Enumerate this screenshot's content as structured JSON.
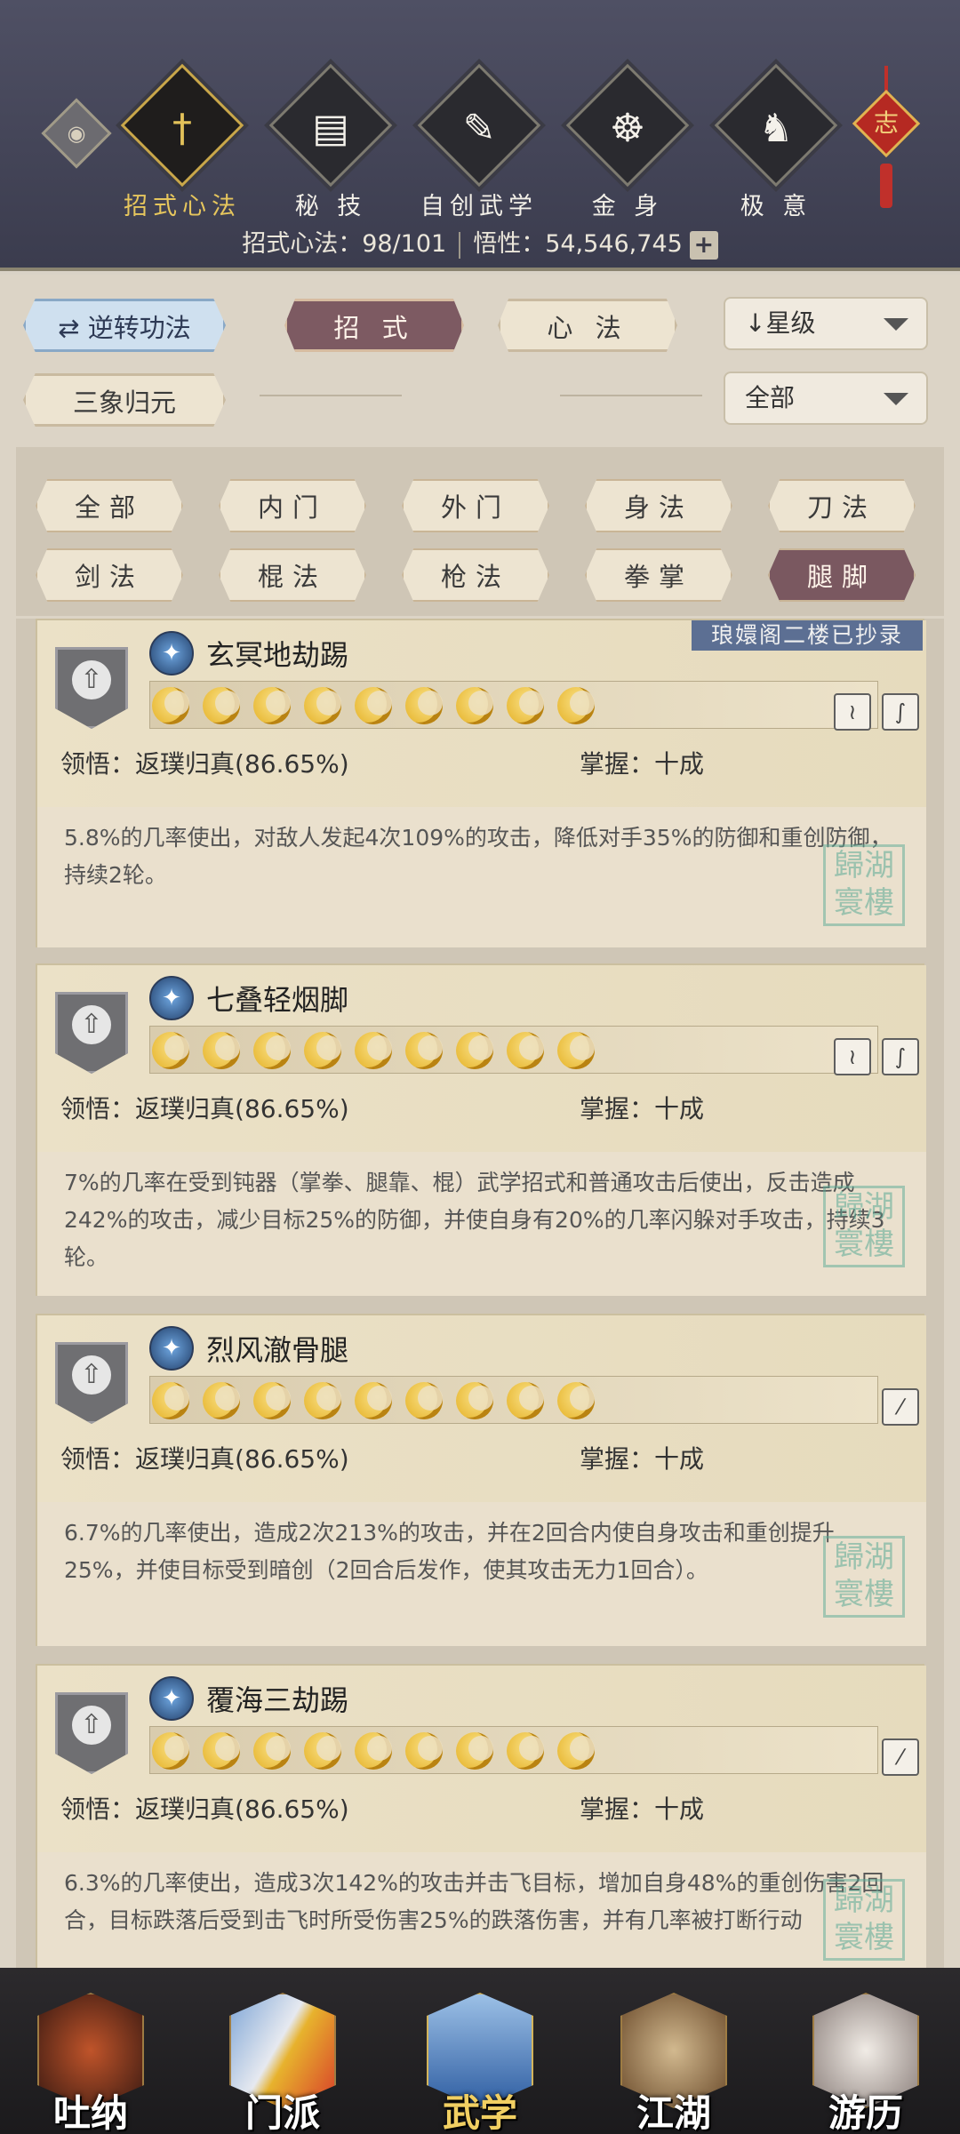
{
  "top_nav": {
    "tabs": [
      {
        "label": "招式心法",
        "icon": "sword-icon",
        "active": true
      },
      {
        "label": "秘 技",
        "icon": "scroll-book-icon",
        "active": false
      },
      {
        "label": "自创武学",
        "icon": "scroll-roll-icon",
        "active": false
      },
      {
        "label": "金 身",
        "icon": "meditation-icon",
        "active": false
      },
      {
        "label": "极 意",
        "icon": "martial-stance-icon",
        "active": false
      }
    ],
    "knot_char": "志",
    "eye_icon": "eye-icon"
  },
  "stats": {
    "skills_label": "招式心法：",
    "skills_value": "98/101",
    "insight_label": "悟性：",
    "insight_value": "54,546,745",
    "add_label": "+"
  },
  "controls": {
    "reverse_button": "逆转功法",
    "moves_tab": "招 式",
    "method_tab": "心 法",
    "sort_select": "星级",
    "sanxiang_button": "三象归元",
    "filter_select": "全部"
  },
  "filters": {
    "row1": [
      "全部",
      "内门",
      "外门",
      "身法",
      "刀法"
    ],
    "row2": [
      "剑法",
      "棍法",
      "枪法",
      "拳掌",
      "腿脚"
    ],
    "selected": "腿脚"
  },
  "skills": [
    {
      "name": "玄冥地劫踢",
      "banner": "琅嬛阁二楼已抄录",
      "stars": 9,
      "tags": [
        "tag-wave-icon",
        "tag-kick-icon"
      ],
      "comprehension_label": "领悟：",
      "comprehension_value": "返璞归真(86.65%)",
      "mastery_label": "掌握：",
      "mastery_value": "十成",
      "description": "5.8%的几率使出，对敌人发起4次109%的攻击，降低对手35%的防御和重创防御，持续2轮。"
    },
    {
      "name": "七叠轻烟脚",
      "banner": "",
      "stars": 9,
      "tags": [
        "tag-wave-icon",
        "tag-kick-icon"
      ],
      "comprehension_label": "领悟：",
      "comprehension_value": "返璞归真(86.65%)",
      "mastery_label": "掌握：",
      "mastery_value": "十成",
      "description": "7%的几率在受到钝器（掌拳、腿靠、棍）武学招式和普通攻击后使出，反击造成242%的攻击，减少目标25%的防御，并使自身有20%的几率闪躲对手攻击，持续3轮。"
    },
    {
      "name": "烈风澈骨腿",
      "banner": "",
      "stars": 9,
      "tags": [
        "tag-slash-icon"
      ],
      "comprehension_label": "领悟：",
      "comprehension_value": "返璞归真(86.65%)",
      "mastery_label": "掌握：",
      "mastery_value": "十成",
      "description": "6.7%的几率使出，造成2次213%的攻击，并在2回合内使自身攻击和重创提升25%，并使目标受到暗创（2回合后发作，使其攻击无力1回合）。"
    },
    {
      "name": "覆海三劫踢",
      "banner": "",
      "stars": 9,
      "tags": [
        "tag-slash-icon"
      ],
      "comprehension_label": "领悟：",
      "comprehension_value": "返璞归真(86.65%)",
      "mastery_label": "掌握：",
      "mastery_value": "十成",
      "description": "6.3%的几率使出，造成3次142%的攻击并击飞目标，增加自身48%的重创伤害2回合，目标跌落后受到击飞时所受伤害25%的跌落伤害，并有几率被打断行动"
    }
  ],
  "stamp_text": "歸湖 寰樓",
  "bottom_nav": [
    {
      "label": "吐纳",
      "icon": "monk-icon",
      "active": false
    },
    {
      "label": "门派",
      "icon": "sect-flags-icon",
      "active": false
    },
    {
      "label": "武学",
      "icon": "manual-book-icon",
      "active": true
    },
    {
      "label": "江湖",
      "icon": "straw-hat-icon",
      "active": false
    },
    {
      "label": "游历",
      "icon": "horse-icon",
      "active": false
    }
  ]
}
